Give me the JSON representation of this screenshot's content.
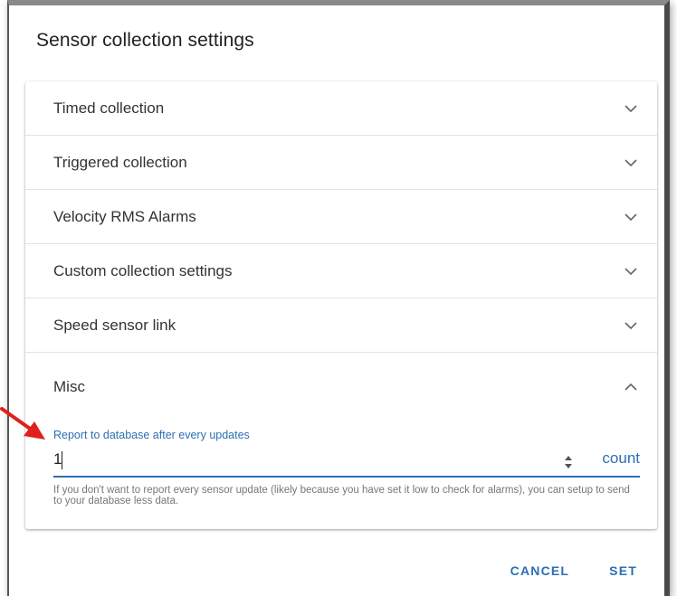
{
  "dialog": {
    "title": "Sensor collection settings"
  },
  "panels": [
    {
      "label": "Timed collection",
      "expanded": false,
      "icon": "chevron-down-icon"
    },
    {
      "label": "Triggered collection",
      "expanded": false,
      "icon": "chevron-down-icon"
    },
    {
      "label": "Velocity RMS Alarms",
      "expanded": false,
      "icon": "chevron-down-icon"
    },
    {
      "label": "Custom collection settings",
      "expanded": false,
      "icon": "chevron-down-icon"
    },
    {
      "label": "Speed sensor link",
      "expanded": false,
      "icon": "chevron-down-icon"
    }
  ],
  "misc": {
    "label": "Misc",
    "expanded": true,
    "icon": "chevron-up-icon",
    "field": {
      "label": "Report to database after every updates",
      "value": "1",
      "unit": "count",
      "helper": "If you don't want to report every sensor update (likely because you have set it low to check for alarms), you can setup to send to your database less data."
    }
  },
  "actions": {
    "cancel_label": "CANCEL",
    "set_label": "SET"
  },
  "colors": {
    "accent": "#2d6fb3",
    "annotation_arrow": "#e0201b"
  }
}
